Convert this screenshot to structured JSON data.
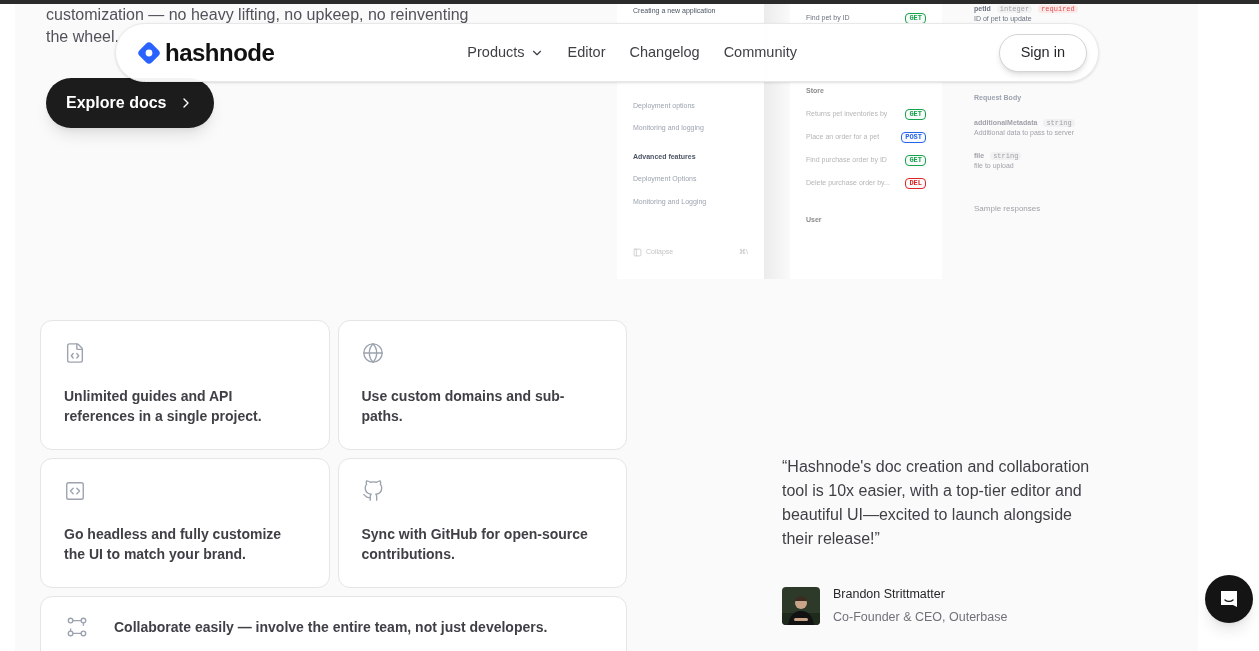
{
  "hero": {
    "lines": [
      "customization — no heavy lifting, no upkeep, no reinventing",
      "the wheel."
    ],
    "button": "Explore docs"
  },
  "nav": {
    "brand": "hashnode",
    "items": [
      {
        "label": "Products",
        "dropdown": true
      },
      {
        "label": "Editor",
        "dropdown": false
      },
      {
        "label": "Changelog",
        "dropdown": false
      },
      {
        "label": "Community",
        "dropdown": false
      }
    ],
    "sign_in": "Sign in"
  },
  "preview": {
    "sidebar": [
      {
        "label": "Creating a new application",
        "kind": "item"
      },
      {
        "label": "Deployment options",
        "kind": "item"
      },
      {
        "label": "Monitoring and logging",
        "kind": "item"
      },
      {
        "label": "Advanced features",
        "kind": "heading"
      },
      {
        "label": "Deployment Options",
        "kind": "item"
      },
      {
        "label": "Monitoring and Logging",
        "kind": "item"
      }
    ],
    "collapse": "Collapse",
    "shortcut": "⌘\\",
    "endpoints": [
      {
        "label": "Find pet by ID",
        "method": "GET",
        "color": "#16a34a"
      },
      {
        "label": "Store",
        "kind": "heading"
      },
      {
        "label": "Returns pet inventories by",
        "method": "GET",
        "color": "#16a34a"
      },
      {
        "label": "Place an order for a pet",
        "method": "POST",
        "color": "#2563eb"
      },
      {
        "label": "Find purchase order by ID",
        "method": "GET",
        "color": "#16a34a"
      },
      {
        "label": "Delete purchase order by...",
        "method": "DEL",
        "color": "#dc2626"
      },
      {
        "label": "User",
        "kind": "heading"
      }
    ],
    "params": [
      {
        "name": "petId",
        "type": "integer",
        "required": "required",
        "description": "ID of pet to update"
      },
      {
        "name": "Request Body",
        "kind": "heading"
      },
      {
        "name": "additionalMetadata",
        "type": "string",
        "description": "Additional data to pass to server"
      },
      {
        "name": "file",
        "type": "string",
        "description": "file to upload"
      }
    ],
    "sample": "Sample responses"
  },
  "features": [
    {
      "kind": "file-code",
      "text": "Unlimited guides and API references in a single project."
    },
    {
      "kind": "globe",
      "text": "Use custom domains and sub-paths."
    },
    {
      "kind": "code",
      "text": "Go headless and fully customize the UI to match your brand."
    },
    {
      "kind": "github",
      "text": "Sync with GitHub for open-source contributions."
    },
    {
      "kind": "nodes",
      "text": "Collaborate easily — involve the entire team, not just developers.",
      "wide": true
    }
  ],
  "testimonial": {
    "quote": "“Hashnode's doc creation and collaboration tool is 10x easier, with a top-tier editor and beautiful UI—excited to launch alongside their release!”",
    "name": "Brandon Strittmatter",
    "role": "Co-Founder & CEO, Outerbase"
  }
}
